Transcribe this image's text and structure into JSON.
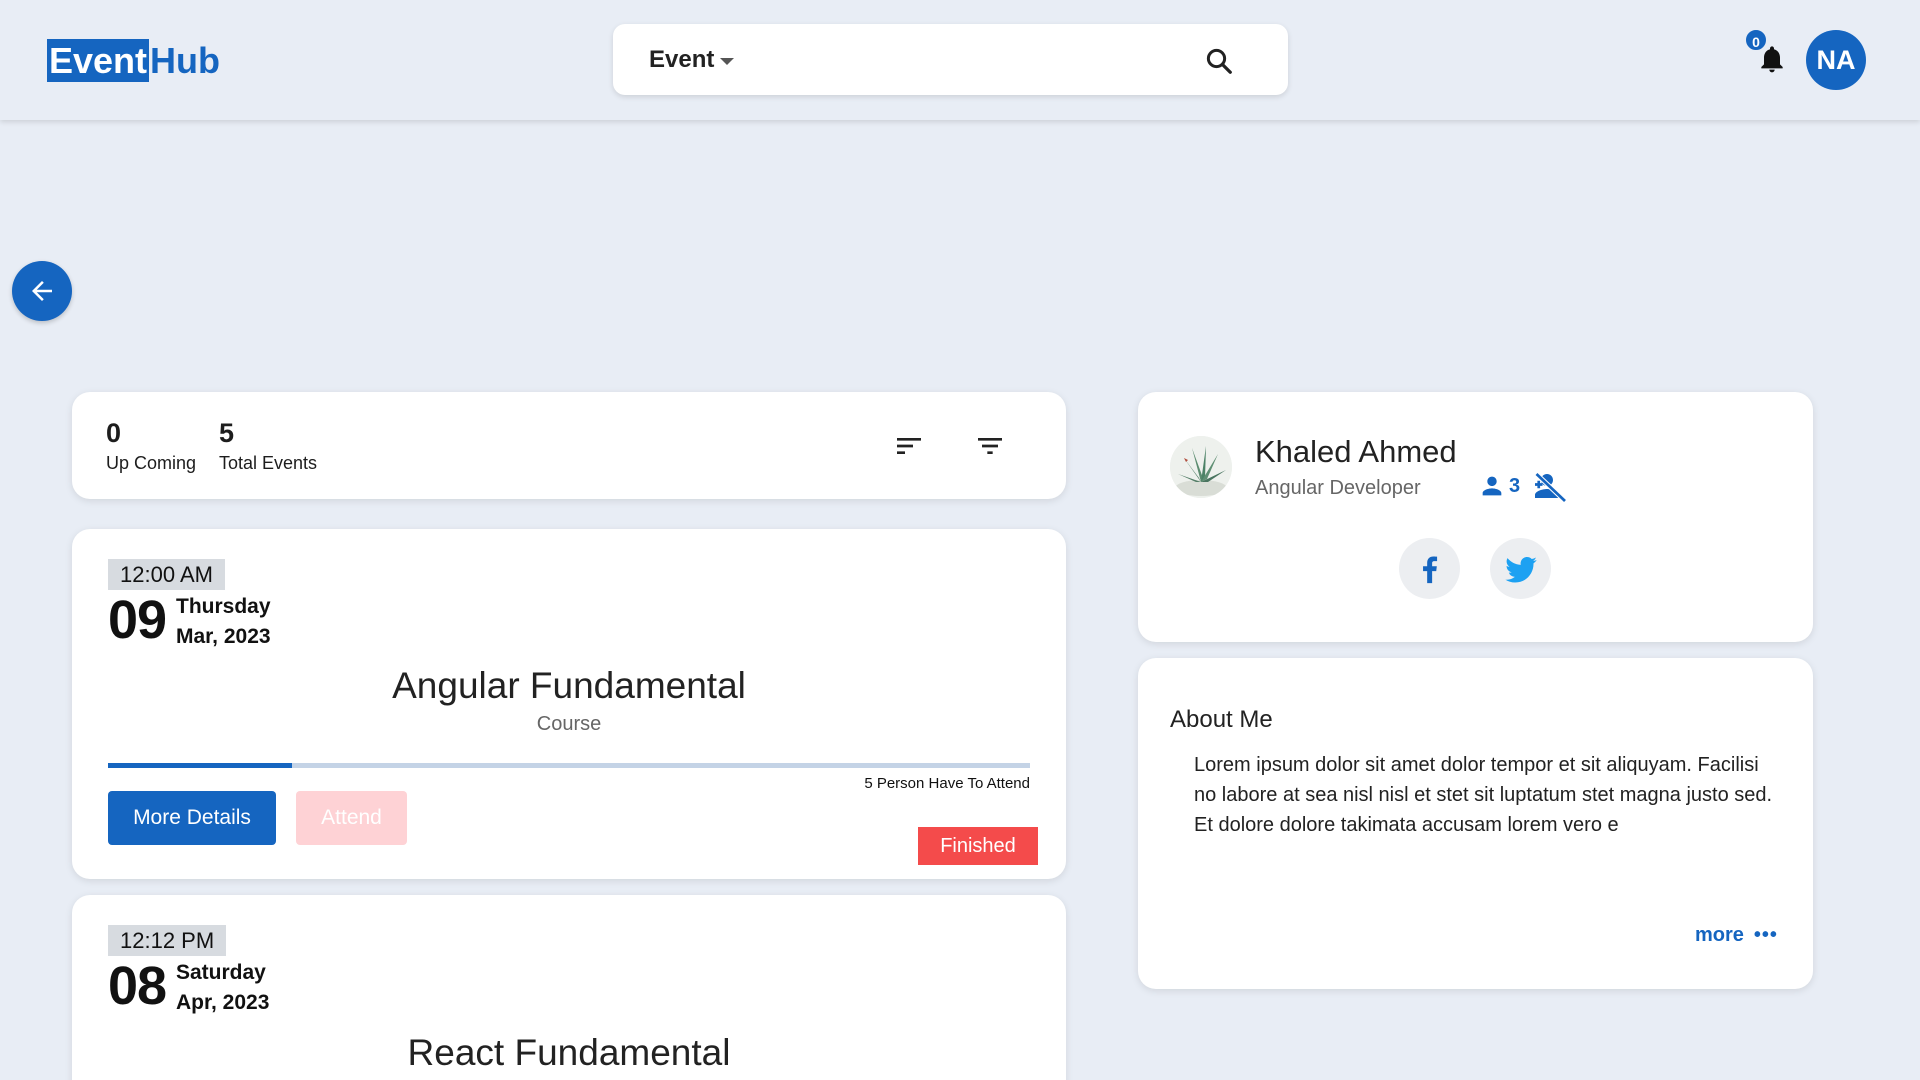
{
  "header": {
    "logo_part1": "Event",
    "logo_part2": "Hub",
    "search_select": "Event",
    "search_placeholder": "",
    "notification_count": "0",
    "user_initials": "NA"
  },
  "stats": {
    "upcoming_count": "0",
    "upcoming_label": "Up Coming",
    "total_count": "5",
    "total_label": "Total Events"
  },
  "events": [
    {
      "time": "12:00 AM",
      "day": "09",
      "weekday": "Thursday",
      "month_year": "Mar, 2023",
      "title": "Angular Fundamental",
      "category": "Course",
      "progress": 0.2,
      "attend_text": "5 Person Have To Attend",
      "more_label": "More Details",
      "attend_label": "Attend",
      "status": "Finished"
    },
    {
      "time": "12:12 PM",
      "day": "08",
      "weekday": "Saturday",
      "month_year": "Apr, 2023",
      "title": "React Fundamental"
    }
  ],
  "profile": {
    "name": "Khaled Ahmed",
    "role": "Angular Developer",
    "followers": "3",
    "facebook_icon": "facebook-icon",
    "twitter_icon": "twitter-icon"
  },
  "about": {
    "heading": "About Me",
    "text": "Lorem ipsum dolor sit amet dolor tempor et sit aliquyam. Facilisi no labore at sea nisl nisl et stet sit luptatum stet magna justo sed. Et dolore dolore takimata accusam lorem vero e",
    "more_label": "more",
    "more_dots": "•••"
  },
  "colors": {
    "primary": "#1565c0",
    "background": "#e8edf5",
    "finished": "#f44b4b",
    "attend_disabled": "#fed2d5",
    "twitter": "#1da1f2"
  }
}
